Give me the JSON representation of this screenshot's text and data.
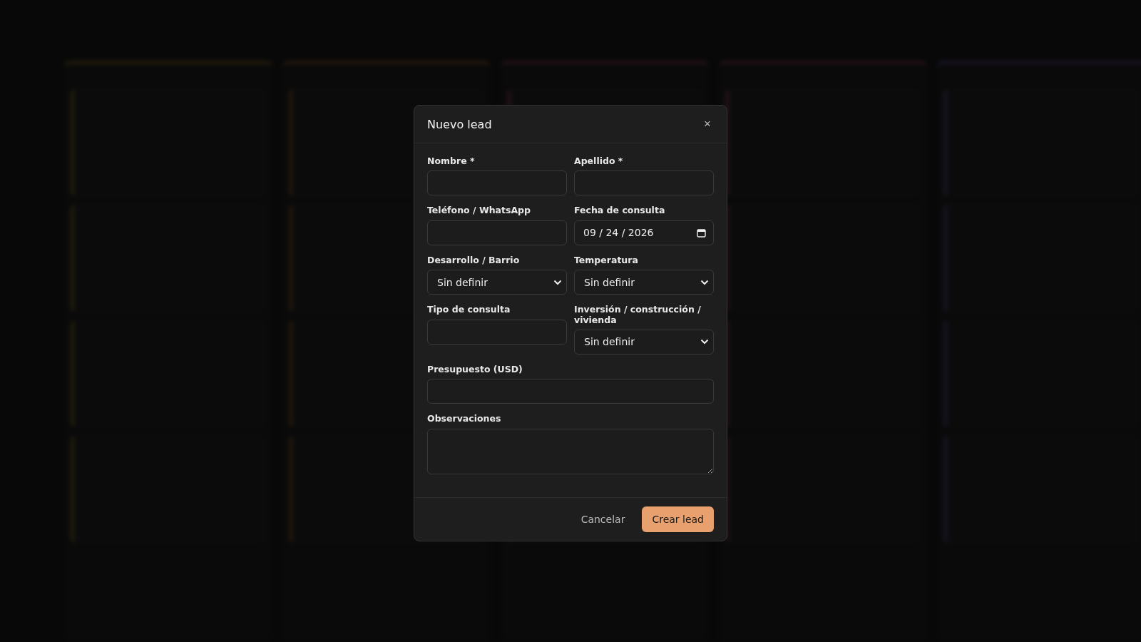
{
  "dialog": {
    "title": "Nuevo lead",
    "close": "×",
    "rows": [
      [
        {
          "kind": "text",
          "label": "Nombre *"
        },
        {
          "kind": "text",
          "label": "Apellido *"
        }
      ],
      [
        {
          "kind": "text",
          "label": "Teléfono / WhatsApp"
        },
        {
          "kind": "date",
          "label": "Fecha de consulta",
          "value": "09 / 24 / 2026"
        }
      ],
      [
        {
          "kind": "select",
          "label": "Desarrollo / Barrio",
          "value": "Sin definir"
        },
        {
          "kind": "select",
          "label": "Temperatura",
          "value": "Sin definir"
        }
      ],
      [
        {
          "kind": "text",
          "label": "Tipo de consulta"
        },
        {
          "kind": "select",
          "label": "Inversión / construcción / vivienda",
          "value": "Sin definir"
        }
      ],
      [
        {
          "kind": "text",
          "label": "Presupuesto (USD)"
        }
      ],
      [
        {
          "kind": "textarea",
          "label": "Observaciones"
        }
      ]
    ],
    "buttons": [
      {
        "kind": "secondary",
        "label": "Cancelar"
      },
      {
        "kind": "primary",
        "label": "Crear lead"
      }
    ]
  }
}
